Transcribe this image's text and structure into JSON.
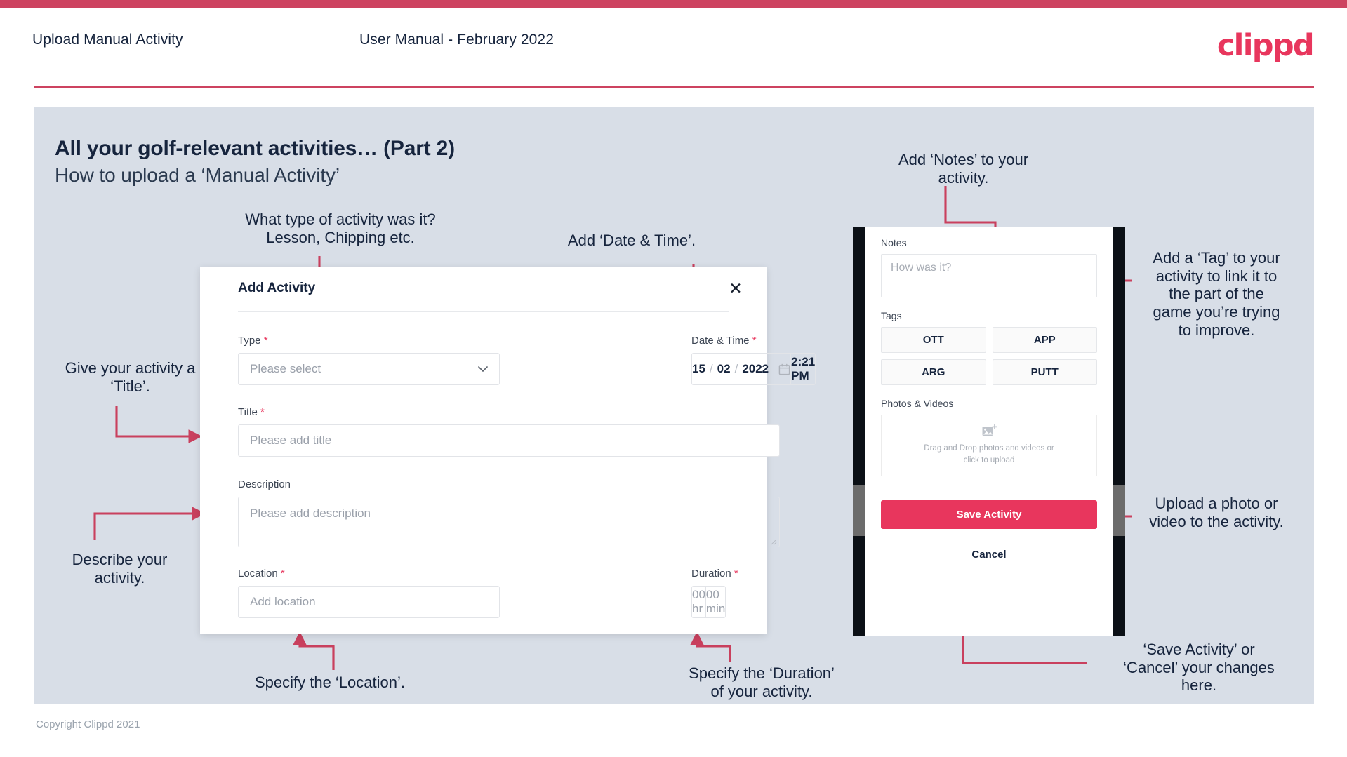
{
  "header": {
    "title": "Upload Manual Activity",
    "subtitle": "User Manual - February 2022",
    "logo": "clippd"
  },
  "slide": {
    "title": "All your golf-relevant activities… (Part 2)",
    "subtitle": "How to upload a ‘Manual Activity’",
    "footer": "Copyright Clippd 2021"
  },
  "annotations": {
    "type": "What type of activity was it?\nLesson, Chipping etc.",
    "datetime": "Add ‘Date & Time’.",
    "title": "Give your activity a\n‘Title’.",
    "description": "Describe your\nactivity.",
    "location": "Specify the ‘Location’.",
    "duration": "Specify the ‘Duration’\nof your activity.",
    "notes": "Add ‘Notes’ to your\nactivity.",
    "tags": "Add a ‘Tag’ to your\nactivity to link it to\nthe part of the\ngame you’re trying\nto improve.",
    "upload": "Upload a photo or\nvideo to the activity.",
    "save": "‘Save Activity’ or\n‘Cancel’ your changes\nhere."
  },
  "dialog": {
    "title": "Add Activity",
    "close_icon": "close-icon",
    "type": {
      "label": "Type",
      "required": "*",
      "placeholder": "Please select"
    },
    "datetime": {
      "label": "Date & Time",
      "required": "*",
      "day": "15",
      "month": "02",
      "year": "2022",
      "sep": "/",
      "time": "2:21 PM"
    },
    "title_field": {
      "label": "Title",
      "required": "*",
      "placeholder": "Please add title"
    },
    "description": {
      "label": "Description",
      "placeholder": "Please add description"
    },
    "location": {
      "label": "Location",
      "required": "*",
      "placeholder": "Add location"
    },
    "duration": {
      "label": "Duration",
      "required": "*",
      "hours_placeholder": "00 hr",
      "minutes_placeholder": "00 min"
    }
  },
  "phone": {
    "notes": {
      "label": "Notes",
      "placeholder": "How was it?"
    },
    "tags": {
      "label": "Tags",
      "items": [
        "OTT",
        "APP",
        "ARG",
        "PUTT"
      ]
    },
    "photos": {
      "label": "Photos & Videos",
      "dropzone_line1": "Drag and Drop photos and videos or",
      "dropzone_line2": "click to upload",
      "icon": "add-image-icon"
    },
    "save_label": "Save Activity",
    "cancel_label": "Cancel"
  },
  "colors": {
    "accent": "#e8365d",
    "arrow": "#c9405e",
    "panel": "#d8dee7",
    "ink": "#16243d"
  }
}
